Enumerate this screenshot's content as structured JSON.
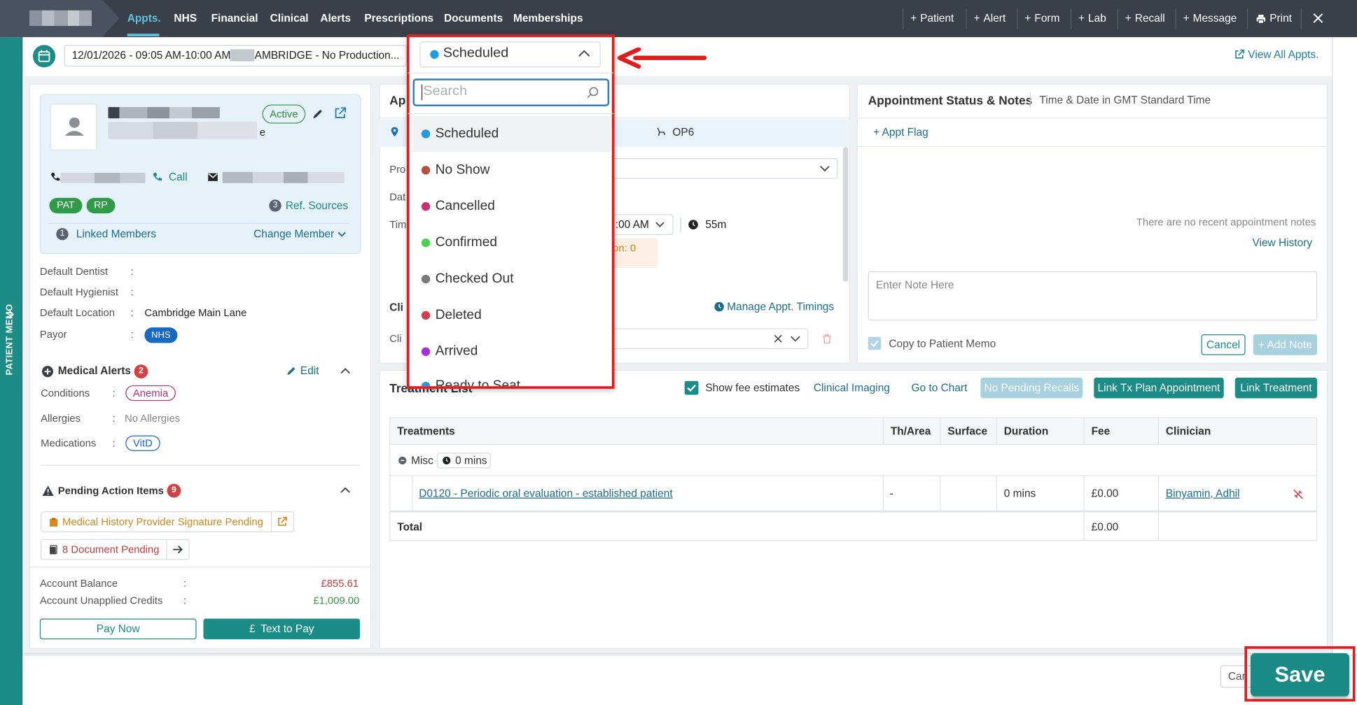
{
  "nav": {
    "tabs": [
      "Appts.",
      "NHS",
      "Financial",
      "Clinical",
      "Alerts",
      "Prescriptions",
      "Documents",
      "Memberships"
    ],
    "actions": [
      "Patient",
      "Alert",
      "Form",
      "Lab",
      "Recall",
      "Message",
      "Print"
    ]
  },
  "strip": {
    "label": "PATIENT MEMO"
  },
  "appt": {
    "selector": "12/01/2026 - 09:05 AM-10:00 AM -      - CAMBRIDGE - No Production...",
    "view_all": "View All Appts."
  },
  "patient": {
    "status": "Active",
    "name_suffix": "e",
    "call": "Call",
    "tags": [
      "PAT",
      "RP"
    ],
    "ref_sources_count": "3",
    "ref_sources": "Ref. Sources",
    "linked_count": "1",
    "linked_members": "Linked Members",
    "change_member": "Change Member",
    "fields": [
      {
        "label": "Default Dentist",
        "value": ""
      },
      {
        "label": "Default Hygienist",
        "value": ""
      },
      {
        "label": "Default Location",
        "value": "Cambridge Main Lane"
      },
      {
        "label": "Payor",
        "value": "NHS"
      }
    ],
    "medical_alerts": {
      "title": "Medical Alerts",
      "count": "2",
      "edit": "Edit",
      "conditions_label": "Conditions",
      "conditions": "Anemia",
      "allergies_label": "Allergies",
      "allergies": "No Allergies",
      "medications_label": "Medications",
      "medications": "VitD"
    },
    "pending": {
      "title": "Pending Action Items",
      "count": "9",
      "item1": "Medical History Provider Signature Pending",
      "item2": "8 Document Pending"
    },
    "account": {
      "balance_label": "Account Balance",
      "balance": "£855.61",
      "credits_label": "Account Unapplied Credits",
      "credits": "£1,009.00",
      "pay_now": "Pay Now",
      "text_to_pay": "Text to Pay"
    }
  },
  "middle": {
    "title_fragment": "Ap",
    "op": "OP6",
    "prov_label": "Pro",
    "date_label": "Dat",
    "time_label": "Tim",
    "time_value": ":00 AM",
    "duration": "55m",
    "warn_fragment": "on: 0",
    "cli_header": "Cli",
    "cli_label": "Cli",
    "manage_timings": "Manage Appt. Timings"
  },
  "status_panel": {
    "title": "Appointment Status & Notes",
    "subtitle": "Time & Date in GMT Standard Time",
    "add_flag": "+ Appt Flag",
    "no_notes": "There are no recent appointment notes",
    "view_history": "View History",
    "note_placeholder": "Enter Note Here",
    "copy_label": "Copy to Patient Memo",
    "cancel": "Cancel",
    "add_note": "+ Add Note"
  },
  "treatment": {
    "title_fragment": "Treatment List",
    "show_fee": "Show fee estimates",
    "clinical_imaging": "Clinical Imaging",
    "go_to_chart": "Go to Chart",
    "no_recalls": "No Pending Recalls",
    "link_tx": "Link Tx Plan Appointment",
    "link_treatment": "Link Treatment",
    "columns": [
      "Treatments",
      "Th/Area",
      "Surface",
      "Duration",
      "Fee",
      "Clinician"
    ],
    "group": "Misc",
    "group_mins": "0 mins",
    "row": {
      "treatment": "D0120 - Periodic oral evaluation - established patient",
      "area": "-",
      "surface": "",
      "duration": "0 mins",
      "fee": "£0.00",
      "clinician": "Binyamin, Adhil"
    },
    "total_label": "Total",
    "total": "£0.00"
  },
  "dropdown": {
    "selected": "Scheduled",
    "search_placeholder": "Search",
    "options": [
      {
        "label": "Scheduled",
        "color": "#1e9be6"
      },
      {
        "label": "No Show",
        "color": "#b5523d"
      },
      {
        "label": "Cancelled",
        "color": "#c8326f"
      },
      {
        "label": "Confirmed",
        "color": "#4bd14b"
      },
      {
        "label": "Checked Out",
        "color": "#7a7a7a"
      },
      {
        "label": "Deleted",
        "color": "#d2404c"
      },
      {
        "label": "Arrived",
        "color": "#a72ee0"
      },
      {
        "label": "Ready to Seat",
        "color": "#1e9be6"
      }
    ]
  },
  "footer": {
    "cancel_fragment": "Car",
    "save": "Save"
  },
  "colors": {
    "accent": "#1c8c86",
    "highlight": "#e01c1c",
    "topbar": "#3a3f4a"
  }
}
